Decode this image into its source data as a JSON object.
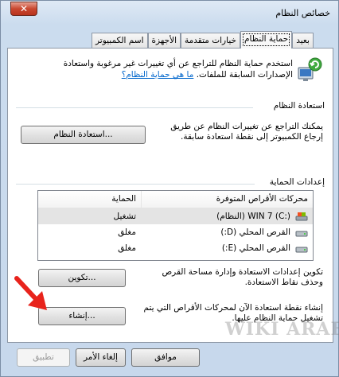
{
  "window": {
    "title": "خصائص النظام",
    "close_label": "✕"
  },
  "tabs": [
    {
      "label": "اسم الكمبيوتر",
      "active": false
    },
    {
      "label": "الأجهزة",
      "active": false
    },
    {
      "label": "خيارات متقدمة",
      "active": false
    },
    {
      "label": "حماية النظام",
      "active": true
    },
    {
      "label": "بعيد",
      "active": false
    }
  ],
  "intro": {
    "text": "استخدم حماية النظام للتراجع عن أي تغييرات غير مرغوبة واستعادة الإصدارات السابقة للملفات.",
    "link": "ما هي حماية النظام؟",
    "icon": "system-protection-icon"
  },
  "restore_section": {
    "heading": "استعادة النظام",
    "description": "يمكنك التراجع عن تغييرات النظام عن طريق إرجاع الكمبيوتر إلى نقطة استعادة سابقة.",
    "button": "استعادة النظام..."
  },
  "protection_section": {
    "heading": "إعدادات الحماية",
    "columns": [
      "محركات الأقراص المتوفرة",
      "الحماية"
    ],
    "rows": [
      {
        "drive": "WIN 7 (C:) (النظام)",
        "protection": "تشغيل",
        "selected": true,
        "icon": "system-drive-icon"
      },
      {
        "drive": "القرص المحلي (D:)",
        "protection": "مغلق",
        "selected": false,
        "icon": "local-disk-icon"
      },
      {
        "drive": "القرص المحلي (E:)",
        "protection": "مغلق",
        "selected": false,
        "icon": "local-disk-icon"
      }
    ],
    "configure_description": "تكوين إعدادات الاستعادة وإدارة مساحة القرص وحذف نقاط الاستعادة.",
    "configure_button": "تكوين...",
    "create_description": "إنشاء نقطة استعادة الآن لمحركات الأقراص التي يتم تشغيل حماية النظام عليها.",
    "create_button": "إنشاء..."
  },
  "footer": {
    "ok": "موافق",
    "cancel": "إلغاء الأمر",
    "apply": "تطبيق"
  },
  "watermark": "WIKI ARABIA"
}
